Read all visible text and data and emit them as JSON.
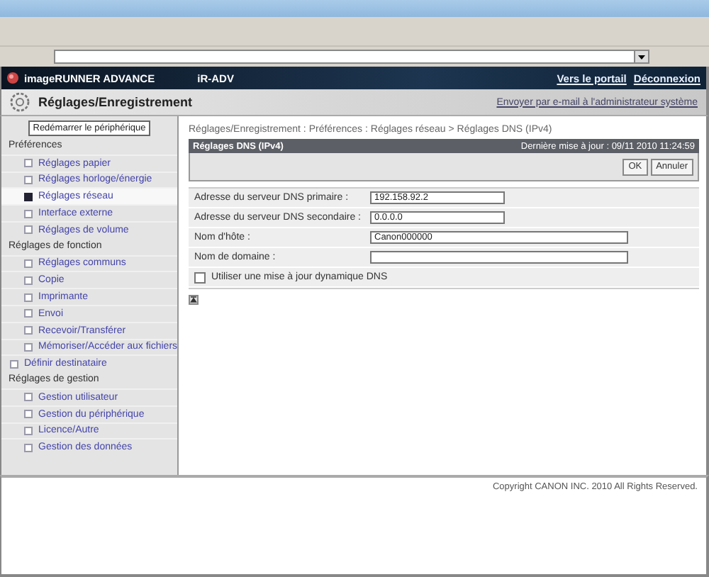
{
  "header": {
    "product": "imageRUNNER ADVANCE",
    "model": "iR-ADV",
    "links": [
      "Vers le portail",
      "Déconnexion"
    ]
  },
  "title_bar": {
    "title": "Réglages/Enregistrement",
    "link": "Envoyer par e-mail à l'administrateur système"
  },
  "sidebar": {
    "restart_button": "Redémarrer le périphérique",
    "entries": [
      {
        "kind": "section",
        "label": "Préférences",
        "children": [
          {
            "label": "Réglages papier",
            "selected": false
          },
          {
            "label": "Réglages horloge/énergie",
            "selected": false
          },
          {
            "label": "Réglages réseau",
            "selected": true
          },
          {
            "label": "Interface externe",
            "selected": false
          },
          {
            "label": "Réglages de volume",
            "selected": false
          }
        ]
      },
      {
        "kind": "section",
        "label": "Réglages de fonction",
        "children": [
          {
            "label": "Réglages communs",
            "selected": false
          },
          {
            "label": "Copie",
            "selected": false
          },
          {
            "label": "Imprimante",
            "selected": false
          },
          {
            "label": "Envoi",
            "selected": false
          },
          {
            "label": "Recevoir/Transférer",
            "selected": false
          },
          {
            "label": "Mémoriser/Accéder aux fichiers",
            "selected": false
          }
        ]
      },
      {
        "kind": "link",
        "label": "Définir destinataire",
        "selected": false
      },
      {
        "kind": "section",
        "label": "Réglages de gestion",
        "children": [
          {
            "label": "Gestion utilisateur",
            "selected": false
          },
          {
            "label": "Gestion du périphérique",
            "selected": false
          },
          {
            "label": "Licence/Autre",
            "selected": false
          },
          {
            "label": "Gestion des données",
            "selected": false
          }
        ]
      }
    ]
  },
  "breadcrumb": "Réglages/Enregistrement : Préférences : Réglages réseau > Réglages DNS (IPv4)",
  "panel": {
    "title": "Réglages DNS (IPv4)",
    "last_update": "Dernière mise à jour : 09/11 2010 11:24:59",
    "buttons": [
      "OK",
      "Annuler"
    ]
  },
  "form": [
    {
      "kind": "text",
      "label": "Adresse du serveur DNS primaire :",
      "value": "192.158.92.2"
    },
    {
      "kind": "text",
      "label": "Adresse du serveur DNS secondaire :",
      "value": "0.0.0.0"
    },
    {
      "kind": "text",
      "label": "Nom d'hôte :",
      "value": "Canon000000"
    },
    {
      "kind": "text",
      "label": "Nom de domaine :"
    },
    {
      "kind": "checkbox",
      "label": "Utiliser une mise à jour dynamique DNS",
      "checked": false
    }
  ],
  "footer": {
    "copyright": "Copyright CANON INC. 2010 All Rights Reserved."
  }
}
